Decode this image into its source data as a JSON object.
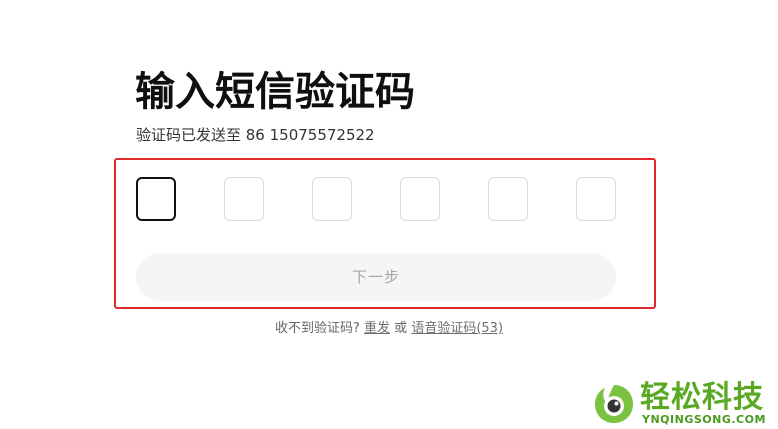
{
  "page": {
    "title": "输入短信验证码",
    "sent_to": "验证码已发送至 86 15075572522"
  },
  "code_inputs": [
    "",
    "",
    "",
    "",
    "",
    ""
  ],
  "next_button": {
    "label": "下一步"
  },
  "footer": {
    "prefix": "收不到验证码?",
    "resend_label": "重发",
    "or_text": "或",
    "voice_label": "语音验证码(53)"
  },
  "watermark": {
    "brand": "轻松科技",
    "site": "YNQINGSONG.COM",
    "icon": "leaf-eye-logo",
    "color": "#5aa823"
  },
  "colors": {
    "highlight_frame": "#e0282b",
    "active_box_border": "#111111",
    "button_bg": "#f5f5f5",
    "button_text": "#a6a6a6"
  }
}
